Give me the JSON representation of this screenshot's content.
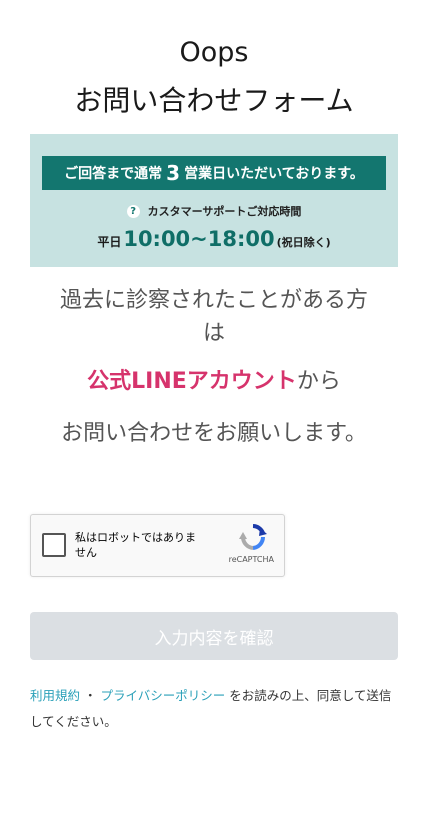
{
  "header": {
    "line1": "Oops",
    "line2": "お問い合わせフォーム"
  },
  "banner": {
    "reply_pre": "ご回答まで通常",
    "reply_days": "3",
    "reply_post": "営業日いただいております。",
    "support_icon": "?",
    "support_label": "カスタマーサポートご対応時間",
    "hours_prefix": "平日",
    "hours": "10:00~18:00",
    "hours_suffix": "(祝日除く)",
    "colors": {
      "background": "#c7e2e1",
      "bar": "#13766f"
    }
  },
  "message": {
    "line1": "過去に診察されたことがある方",
    "line1b": "は",
    "link_text": "公式LINEアカウント",
    "line2_post": "から",
    "line3": "お問い合わせをお願いします。",
    "link_color": "#d6336c"
  },
  "recaptcha": {
    "label": "私はロボットではありません",
    "brand": "reCAPTCHA",
    "icon": "recaptcha-logo-icon"
  },
  "submit": {
    "label": "入力内容を確認"
  },
  "terms": {
    "terms_link": "利用規約",
    "separator": " ・ ",
    "privacy_link": "プライバシーポリシー",
    "suffix": " をお読みの上、同意して送信してください。",
    "link_color": "#2aa0b8"
  }
}
